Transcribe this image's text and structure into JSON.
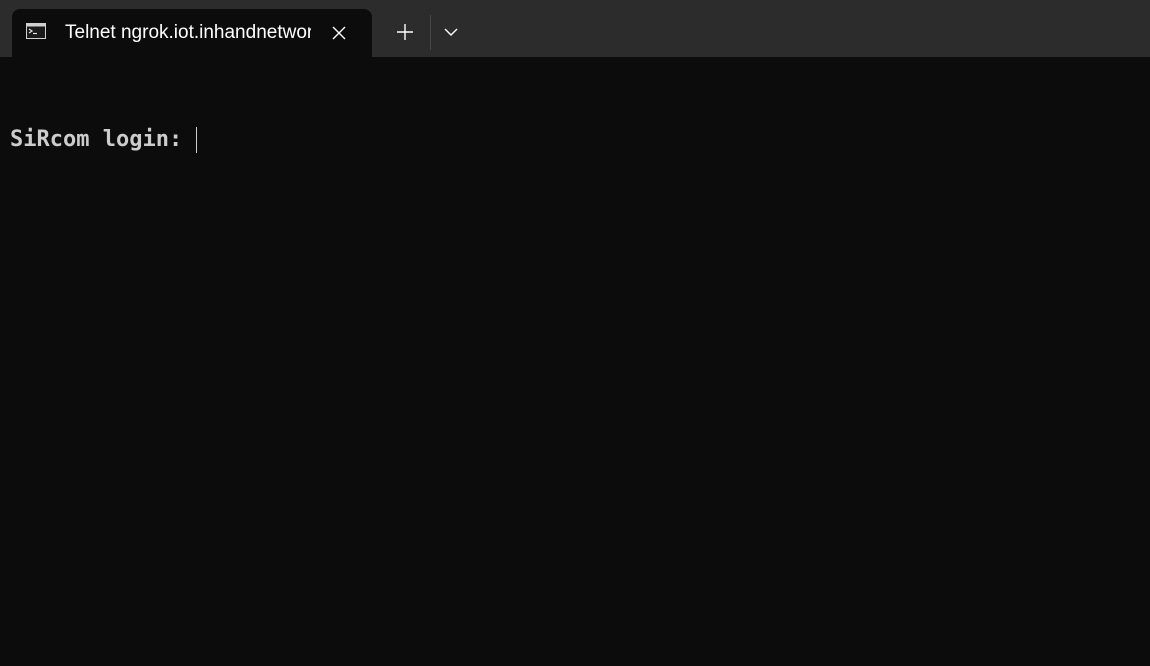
{
  "tab": {
    "title": "Telnet ngrok.iot.inhandnetworks.com",
    "icon": "terminal-icon"
  },
  "buttons": {
    "close_icon": "close-icon",
    "new_tab_icon": "plus-icon",
    "dropdown_icon": "chevron-down-icon"
  },
  "terminal": {
    "prompt": "SiRcom login:",
    "input": ""
  },
  "colors": {
    "tabbar_bg": "#2c2c2c",
    "terminal_bg": "#0c0c0c",
    "terminal_text": "#cccccc",
    "tab_text": "#ffffff"
  }
}
